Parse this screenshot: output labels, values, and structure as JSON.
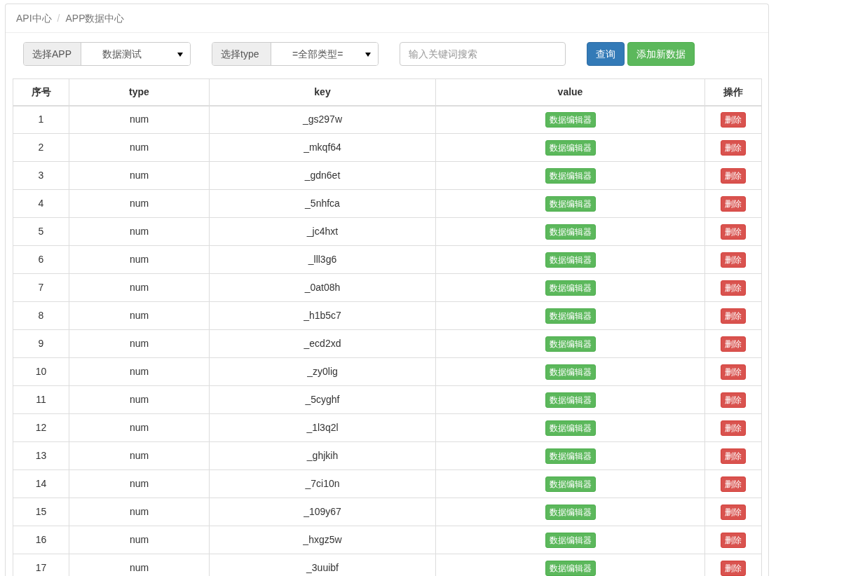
{
  "breadcrumb": {
    "items": [
      "API中心",
      "APP数据中心"
    ],
    "separator": "/"
  },
  "filters": [
    {
      "label": "选择APP",
      "value": "数据测试"
    },
    {
      "label": "选择type",
      "value": "=全部类型="
    }
  ],
  "search": {
    "placeholder": "输入关键词搜索"
  },
  "buttons": [
    {
      "label": "查询",
      "kind": "primary"
    },
    {
      "label": "添加新数据",
      "kind": "success"
    }
  ],
  "table": {
    "columns": [
      "序号",
      "type",
      "key",
      "value",
      "操作"
    ],
    "rows": [
      {
        "index": "1",
        "type": "num",
        "key": "_gs297w",
        "value_button": "数据编辑器",
        "action_button": "删除"
      },
      {
        "index": "2",
        "type": "num",
        "key": "_mkqf64",
        "value_button": "数据编辑器",
        "action_button": "删除"
      },
      {
        "index": "3",
        "type": "num",
        "key": "_gdn6et",
        "value_button": "数据编辑器",
        "action_button": "删除"
      },
      {
        "index": "4",
        "type": "num",
        "key": "_5nhfca",
        "value_button": "数据编辑器",
        "action_button": "删除"
      },
      {
        "index": "5",
        "type": "num",
        "key": "_jc4hxt",
        "value_button": "数据编辑器",
        "action_button": "删除"
      },
      {
        "index": "6",
        "type": "num",
        "key": "_lll3g6",
        "value_button": "数据编辑器",
        "action_button": "删除"
      },
      {
        "index": "7",
        "type": "num",
        "key": "_0at08h",
        "value_button": "数据编辑器",
        "action_button": "删除"
      },
      {
        "index": "8",
        "type": "num",
        "key": "_h1b5c7",
        "value_button": "数据编辑器",
        "action_button": "删除"
      },
      {
        "index": "9",
        "type": "num",
        "key": "_ecd2xd",
        "value_button": "数据编辑器",
        "action_button": "删除"
      },
      {
        "index": "10",
        "type": "num",
        "key": "_zy0lig",
        "value_button": "数据编辑器",
        "action_button": "删除"
      },
      {
        "index": "11",
        "type": "num",
        "key": "_5cyghf",
        "value_button": "数据编辑器",
        "action_button": "删除"
      },
      {
        "index": "12",
        "type": "num",
        "key": "_1l3q2l",
        "value_button": "数据编辑器",
        "action_button": "删除"
      },
      {
        "index": "13",
        "type": "num",
        "key": "_ghjkih",
        "value_button": "数据编辑器",
        "action_button": "删除"
      },
      {
        "index": "14",
        "type": "num",
        "key": "_7ci10n",
        "value_button": "数据编辑器",
        "action_button": "删除"
      },
      {
        "index": "15",
        "type": "num",
        "key": "_109y67",
        "value_button": "数据编辑器",
        "action_button": "删除"
      },
      {
        "index": "16",
        "type": "num",
        "key": "_hxgz5w",
        "value_button": "数据编辑器",
        "action_button": "删除"
      },
      {
        "index": "17",
        "type": "num",
        "key": "_3uuibf",
        "value_button": "数据编辑器",
        "action_button": "删除"
      }
    ]
  }
}
